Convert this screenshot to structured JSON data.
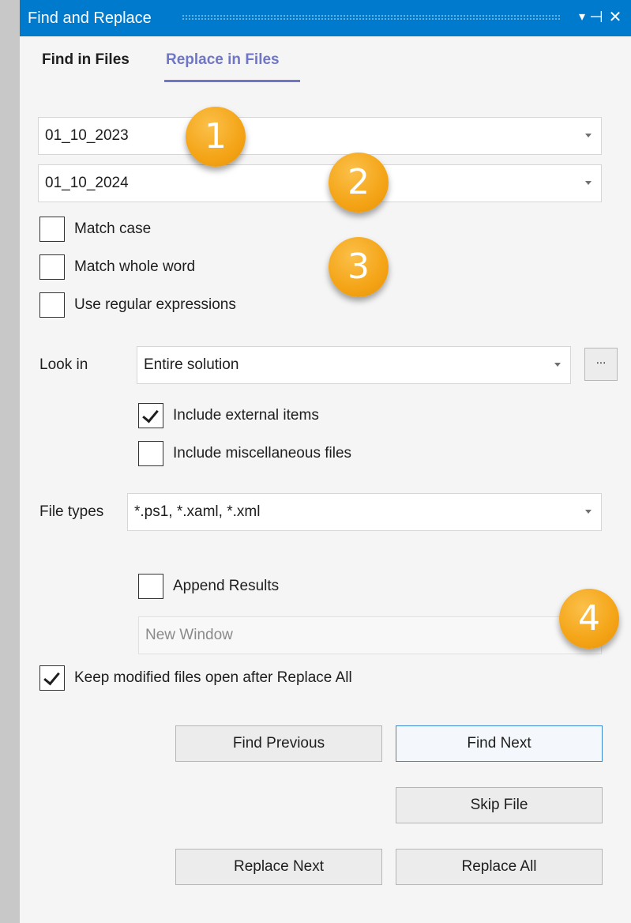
{
  "window": {
    "title": "Find and Replace",
    "controls": {
      "dropdown": "▾",
      "pin": "⊣",
      "close": "✕"
    }
  },
  "tabs": [
    {
      "label": "Find in Files",
      "active": false
    },
    {
      "label": "Replace in Files",
      "active": true
    }
  ],
  "find": {
    "value": "01_10_2023"
  },
  "replace": {
    "value": "01_10_2024"
  },
  "options": {
    "match_case": {
      "label": "Match case",
      "checked": false
    },
    "match_whole_word": {
      "label": "Match whole word",
      "checked": false
    },
    "use_regex": {
      "label": "Use regular expressions",
      "checked": false
    }
  },
  "look_in": {
    "label": "Look in",
    "value": "Entire solution",
    "browse_label": "...",
    "include_external": {
      "label": "Include external items",
      "checked": true
    },
    "include_misc": {
      "label": "Include miscellaneous files",
      "checked": false
    }
  },
  "file_types": {
    "label": "File types",
    "value": "*.ps1, *.xaml, *.xml"
  },
  "results": {
    "append": {
      "label": "Append Results",
      "checked": false
    },
    "window": "New Window"
  },
  "keep_open": {
    "label": "Keep modified files open after Replace All",
    "checked": true
  },
  "buttons": {
    "find_previous": "Find Previous",
    "find_next": "Find Next",
    "skip_file": "Skip File",
    "replace_next": "Replace Next",
    "replace_all": "Replace All"
  },
  "badges": [
    "1",
    "2",
    "3",
    "4"
  ],
  "colors": {
    "titlebar": "#007acc",
    "active_tab": "#6f76c8",
    "badge": "#f4a416"
  }
}
